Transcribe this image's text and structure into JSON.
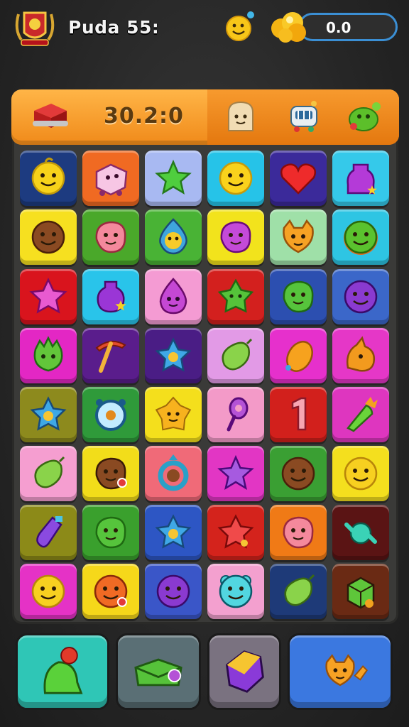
{
  "player": {
    "name": "Puda 55:"
  },
  "currency": {
    "value": "0.0"
  },
  "header": {
    "timer": "30.2:0"
  },
  "colors": {
    "orange": "#f08a1a",
    "frame": "#3a3a38",
    "coinBorder": "#3b8fd4"
  },
  "board": {
    "rows": [
      [
        {
          "bg": "#1d3b80",
          "icon": "lemon-face"
        },
        {
          "bg": "#f06a22",
          "icon": "cube-critter"
        },
        {
          "bg": "#a8b9f2",
          "icon": "star"
        },
        {
          "bg": "#26c3e8",
          "icon": "smiley"
        },
        {
          "bg": "#3b2a9a",
          "icon": "heart"
        },
        {
          "bg": "#35c9ea",
          "icon": "potion"
        }
      ],
      [
        {
          "bg": "#f6e020",
          "icon": "brown-face"
        },
        {
          "bg": "#4aa82a",
          "icon": "pink-blob"
        },
        {
          "bg": "#49b335",
          "icon": "drop-face"
        },
        {
          "bg": "#f2e31c",
          "icon": "purple-blob"
        },
        {
          "bg": "#9fe0a8",
          "icon": "orange-cat"
        },
        {
          "bg": "#2ec5e3",
          "icon": "green-flower"
        }
      ],
      [
        {
          "bg": "#d9141d",
          "icon": "pink-star"
        },
        {
          "bg": "#29c4ea",
          "icon": "purple-potion"
        },
        {
          "bg": "#f49bd3",
          "icon": "purple-drop"
        },
        {
          "bg": "#d3201e",
          "icon": "green-star"
        },
        {
          "bg": "#2c4fb0",
          "icon": "green-blob"
        },
        {
          "bg": "#3b67c9",
          "icon": "purple-ball"
        }
      ],
      [
        {
          "bg": "#e327c4",
          "icon": "green-spiky"
        },
        {
          "bg": "#5a1d8c",
          "icon": "pickaxe"
        },
        {
          "bg": "#4a1d85",
          "icon": "blue-star"
        },
        {
          "bg": "#e29ae6",
          "icon": "green-pear"
        },
        {
          "bg": "#e630cc",
          "icon": "orange-lemon"
        },
        {
          "bg": "#e537c7",
          "icon": "orange-fox"
        }
      ],
      [
        {
          "bg": "#8d8a1d",
          "icon": "blue-star"
        },
        {
          "bg": "#2f9a3a",
          "icon": "clock"
        },
        {
          "bg": "#f4df1c",
          "icon": "sun"
        },
        {
          "bg": "#f39ac8",
          "icon": "key"
        },
        {
          "bg": "#d2201c",
          "icon": "number-one"
        },
        {
          "bg": "#de36bf",
          "icon": "carrot"
        }
      ],
      [
        {
          "bg": "#f59ed0",
          "icon": "green-pear"
        },
        {
          "bg": "#f2dd1a",
          "icon": "brown-blob"
        },
        {
          "bg": "#f06a78",
          "icon": "ring"
        },
        {
          "bg": "#e236c4",
          "icon": "purple-star"
        },
        {
          "bg": "#3a9f33",
          "icon": "brown-face"
        },
        {
          "bg": "#f4df1e",
          "icon": "yellow-face"
        }
      ],
      [
        {
          "bg": "#8c8a18",
          "icon": "purple-bottle"
        },
        {
          "bg": "#3aa02d",
          "icon": "green-blob"
        },
        {
          "bg": "#2d56c4",
          "icon": "blue-star"
        },
        {
          "bg": "#d4231c",
          "icon": "red-star"
        },
        {
          "bg": "#f07a16",
          "icon": "pink-blob"
        },
        {
          "bg": "#5a1414",
          "icon": "teal-candy"
        }
      ],
      [
        {
          "bg": "#e532c6",
          "icon": "yellow-face"
        },
        {
          "bg": "#f6d81a",
          "icon": "orange-ball"
        },
        {
          "bg": "#3a56c8",
          "icon": "purple-ball"
        },
        {
          "bg": "#f3a0cf",
          "icon": "teal-bear"
        },
        {
          "bg": "#1e3a78",
          "icon": "green-pear"
        },
        {
          "bg": "#6a2a14",
          "icon": "green-cube"
        }
      ]
    ]
  },
  "bottom": [
    {
      "bg": "#2fc6b6",
      "icon": "green-bell"
    },
    {
      "bg": "#5a6f75",
      "icon": "green-envelope"
    },
    {
      "bg": "#7a7280",
      "icon": "purple-gem"
    },
    {
      "bg": "#3b78e0",
      "icon": "orange-cat"
    }
  ]
}
